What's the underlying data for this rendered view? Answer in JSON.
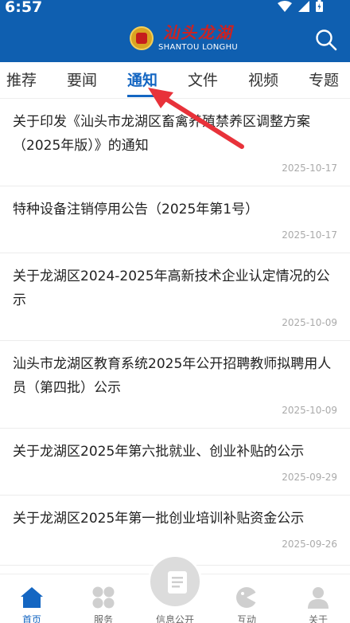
{
  "status_bar": {
    "time": "6:57"
  },
  "header": {
    "logo_cn": "汕头龙湖",
    "logo_en": "SHANTOU LONGHU",
    "search_icon": "search-icon"
  },
  "tabs": [
    {
      "label": "推荐",
      "active": false
    },
    {
      "label": "要闻",
      "active": false
    },
    {
      "label": "通知",
      "active": true
    },
    {
      "label": "文件",
      "active": false
    },
    {
      "label": "视频",
      "active": false
    },
    {
      "label": "专题",
      "active": false
    }
  ],
  "list": [
    {
      "title": "关于印发《汕头市龙湖区畜禽养殖禁养区调整方案（2025年版）》的通知",
      "date": "2025-10-17"
    },
    {
      "title": "特种设备注销停用公告（2025年第1号）",
      "date": "2025-10-17"
    },
    {
      "title": "关于龙湖区2024-2025年高新技术企业认定情况的公示",
      "date": "2025-10-09"
    },
    {
      "title": "汕头市龙湖区教育系统2025年公开招聘教师拟聘用人员（第四批）公示",
      "date": "2025-10-09"
    },
    {
      "title": "关于龙湖区2025年第六批就业、创业补贴的公示",
      "date": "2025-09-29"
    },
    {
      "title": "关于龙湖区2025年第一批创业培训补贴资金公示",
      "date": "2025-09-26"
    }
  ],
  "bottom_nav": [
    {
      "label": "首页",
      "icon": "home-icon",
      "active": true
    },
    {
      "label": "服务",
      "icon": "grid-icon",
      "active": false
    },
    {
      "label": "信息公开",
      "icon": "document-icon",
      "active": false
    },
    {
      "label": "互动",
      "icon": "chat-icon",
      "active": false
    },
    {
      "label": "关于",
      "icon": "person-icon",
      "active": false
    }
  ],
  "colors": {
    "brand_blue": "#0f5fb0",
    "active_tab": "#1466c2",
    "arrow_red": "#e8323a"
  }
}
